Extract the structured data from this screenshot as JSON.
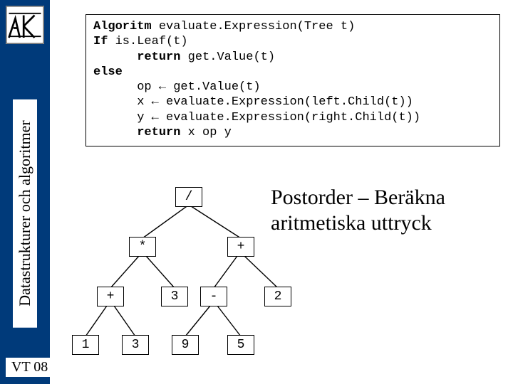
{
  "sidebar": {
    "course_title": "Datastrukturer och algoritmer"
  },
  "footer": {
    "term": "VT 08"
  },
  "algorithm": {
    "l1a": "Algoritm",
    "l1b": " evaluate.Expression(Tree t)",
    "l2a": "If",
    "l2b": " is.Leaf(t)",
    "l3a": "      ",
    "l3b": "return",
    "l3c": " get.Value(t)",
    "l4a": "else",
    "l5": "      op ← get.Value(t)",
    "l6": "      x ← evaluate.Expression(left.Child(t))",
    "l7": "      y ← evaluate.Expression(right.Child(t))",
    "l8a": "      ",
    "l8b": "return",
    "l8c": " x op y"
  },
  "heading": {
    "line1": "Postorder – Beräkna",
    "line2": "aritmetiska uttryck"
  },
  "tree": {
    "root": "/",
    "n_mul": "*",
    "n_plusR": "+",
    "n_plusL": "+",
    "n_3a": "3",
    "n_minus": "-",
    "n_2": "2",
    "n_1": "1",
    "n_3b": "3",
    "n_9": "9",
    "n_5": "5"
  }
}
